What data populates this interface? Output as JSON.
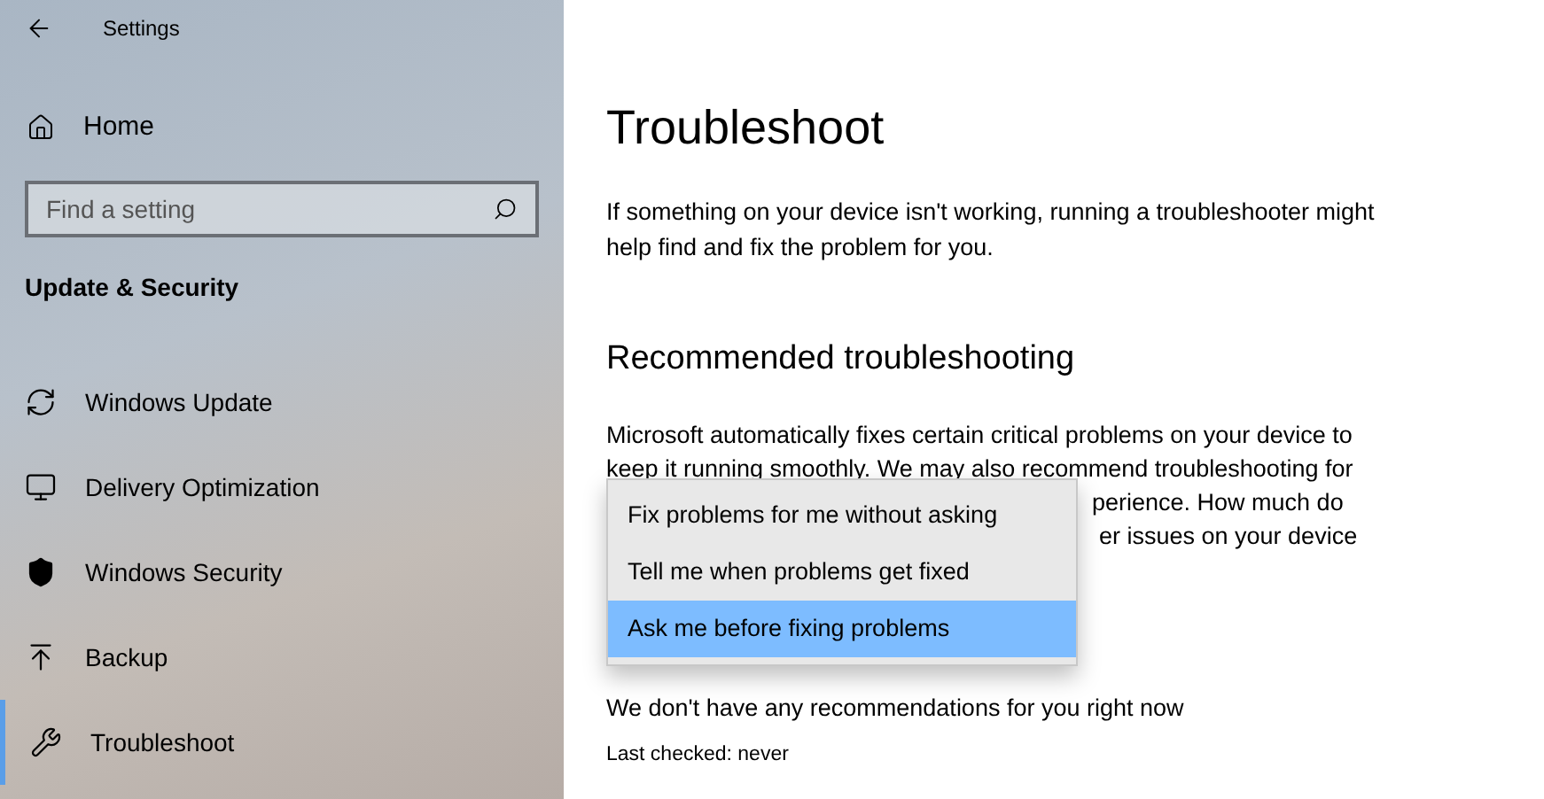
{
  "window": {
    "title": "Settings"
  },
  "sidebar": {
    "home": "Home",
    "search": {
      "placeholder": "Find a setting"
    },
    "section": "Update & Security",
    "items": [
      {
        "label": "Windows Update",
        "selected": false
      },
      {
        "label": "Delivery Optimization",
        "selected": false
      },
      {
        "label": "Windows Security",
        "selected": false
      },
      {
        "label": "Backup",
        "selected": false
      },
      {
        "label": "Troubleshoot",
        "selected": true
      }
    ]
  },
  "main": {
    "title": "Troubleshoot",
    "intro": "If something on your device isn't working, running a troubleshooter might help find and fix the problem for you.",
    "heading": "Recommended troubleshooting",
    "paragraph_lines": [
      "Microsoft automatically fixes certain critical problems on your device to",
      "keep it running smoothly. We may also recommend troubleshooting for",
      "perience. How much do",
      "er issues on your device"
    ],
    "dropdown": {
      "options": [
        {
          "label": "Fix problems for me without asking",
          "selected": false
        },
        {
          "label": "Tell me when problems get fixed",
          "selected": false
        },
        {
          "label": "Ask me before fixing problems",
          "selected": true
        }
      ]
    },
    "status": "We don't have any recommendations for you right now",
    "last_checked": "Last checked: never"
  }
}
